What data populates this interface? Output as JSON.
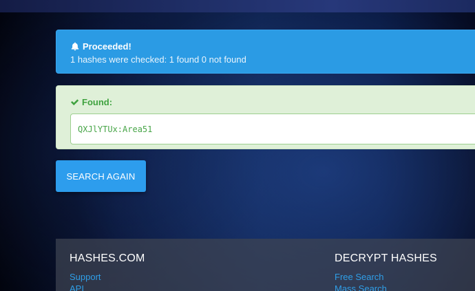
{
  "alert_info": {
    "title": "Proceeded!",
    "message": "1 hashes were checked: 1 found 0 not found",
    "icon": "bell-icon"
  },
  "alert_success": {
    "title": "Found:",
    "icon": "check-icon",
    "result": "QXJlYTUx:Area51"
  },
  "actions": {
    "search_again": "SEARCH AGAIN"
  },
  "footer": {
    "col1": {
      "heading": "HASHES.COM",
      "links": [
        "Support",
        "API"
      ]
    },
    "col2": {
      "heading": "DECRYPT HASHES",
      "links": [
        "Free Search",
        "Mass Search"
      ]
    }
  },
  "colors": {
    "info": "#2b9be4",
    "success_bg": "#dff0d8",
    "success_text": "#3fa23f",
    "button": "#2d9ded",
    "link": "#2f9fe8"
  }
}
